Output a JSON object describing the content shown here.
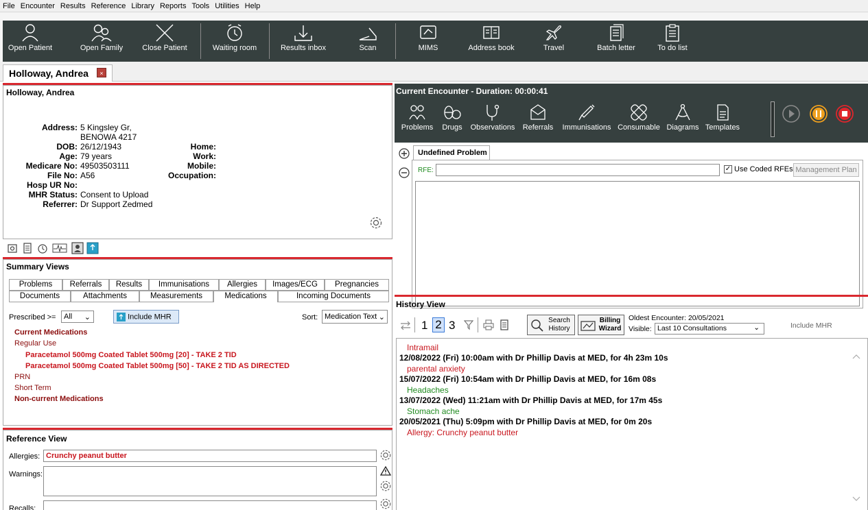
{
  "menu": [
    "File",
    "Encounter",
    "Results",
    "Reference",
    "Library",
    "Reports",
    "Tools",
    "Utilities",
    "Help"
  ],
  "toolbar": {
    "open_patient": "Open Patient",
    "open_family": "Open Family",
    "close_patient": "Close Patient",
    "waiting_room": "Waiting room",
    "results_inbox": "Results inbox",
    "scan": "Scan",
    "mims": "MIMS",
    "address_book": "Address book",
    "travel": "Travel",
    "batch_letter": "Batch letter",
    "todo_list": "To do list"
  },
  "patient_tab": {
    "name": "Holloway, Andrea",
    "close": "×"
  },
  "patient": {
    "name": "Holloway, Andrea",
    "labels": {
      "address": "Address:",
      "dob": "DOB:",
      "age": "Age:",
      "medicare": "Medicare No:",
      "file": "File No:",
      "hosp": "Hosp UR No:",
      "mhr": "MHR Status:",
      "referrer": "Referrer:",
      "home": "Home:",
      "work": "Work:",
      "mobile": "Mobile:",
      "occupation": "Occupation:"
    },
    "address_line1": "5 Kingsley  Gr,",
    "address_line2": "BENOWA  4217",
    "dob": "26/12/1943",
    "age": "79 years",
    "medicare": "49503503111",
    "file": "A56",
    "mhr": "Consent to Upload",
    "referrer": "Dr Support Zedmed"
  },
  "summary": {
    "title": "Summary Views",
    "tabs_row1": [
      "Problems",
      "Referrals",
      "Results",
      "Immunisations",
      "Allergies",
      "Images/ECG",
      "Pregnancies"
    ],
    "tabs_row2": [
      "Documents",
      "Attachments",
      "Measurements",
      "Medications",
      "Incoming Documents"
    ],
    "prescribed_label": "Prescribed >=",
    "prescribed_value": "All",
    "include_mhr": "Include MHR",
    "sort_label": "Sort:",
    "sort_value": "Medication Text",
    "current": "Current Medications",
    "regular": "Regular Use",
    "med1": "Paracetamol 500mg Coated Tablet 500mg [20] - TAKE 2 TID",
    "med2": "Paracetamol 500mg Coated Tablet 500mg [50] - TAKE 2 TID AS DIRECTED",
    "prn": "PRN",
    "short_term": "Short Term",
    "noncurrent": "Non-current Medications"
  },
  "reference": {
    "title": "Reference View",
    "allergies_label": "Allergies:",
    "allergies_value": "Crunchy peanut butter",
    "warnings_label": "Warnings:",
    "recalls_label": "Recalls:"
  },
  "encounter": {
    "title": "Current Encounter - Duration: 00:00:41",
    "buttons": [
      "Problems",
      "Drugs",
      "Observations",
      "Referrals",
      "Immunisations",
      "Consumable",
      "Diagrams",
      "Templates"
    ],
    "problem_tab": "Undefined Problem",
    "rfe_label": "RFE:",
    "use_coded": "Use Coded RFEs",
    "management_plan": "Management Plan"
  },
  "history": {
    "title": "History View",
    "pages": [
      "1",
      "2",
      "3"
    ],
    "search": "Search History",
    "billing": "Billing Wizard",
    "oldest_label": "Oldest Encounter: 20/05/2021",
    "visible_label": "Visible:",
    "visible_value": "Last 10 Consultations",
    "include_mhr": "Include MHR",
    "entries": [
      {
        "text": "Intramail",
        "kind": "red"
      },
      {
        "text": "12/08/2022 (Fri) 10:00am with Dr Phillip Davis at MED, for 4h 23m 10s",
        "kind": "head"
      },
      {
        "text": "parental anxiety",
        "kind": "red"
      },
      {
        "text": "15/07/2022 (Fri) 10:54am with Dr Phillip Davis at MED, for 16m 08s",
        "kind": "head"
      },
      {
        "text": "Headaches",
        "kind": "green"
      },
      {
        "text": "13/07/2022 (Wed) 11:21am with Dr Phillip Davis at MED, for 17m 45s",
        "kind": "head"
      },
      {
        "text": "Stomach ache",
        "kind": "green"
      },
      {
        "text": "20/05/2021 (Thu) 5:09pm with Dr Phillip Davis at MED, for 0m 20s",
        "kind": "head"
      },
      {
        "text": "Allergy: Crunchy peanut butter",
        "kind": "red"
      }
    ]
  },
  "colors": {
    "accent_red": "#d9282f",
    "toolbar_bg": "#36403f",
    "pause": "#f0a01e",
    "stop": "#e0262c"
  }
}
